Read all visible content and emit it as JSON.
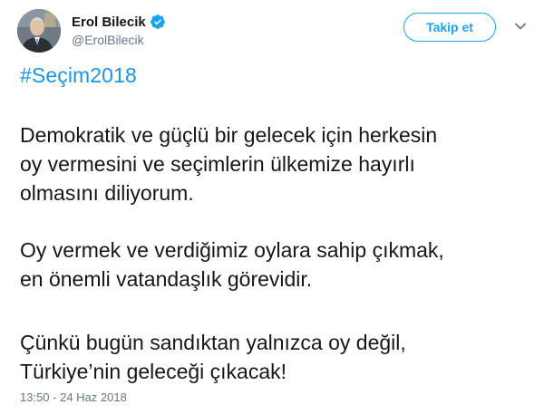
{
  "user": {
    "display_name": "Erol Bilecik",
    "handle": "@ErolBilecik",
    "verified": true
  },
  "actions": {
    "follow_label": "Takip et"
  },
  "tweet": {
    "hashtag": "#Seçim2018",
    "paragraphs": [
      [
        "Demokratik ve güçlü bir gelecek için herkesin",
        "oy vermesini ve seçimlerin ülkemize hayırlı",
        "olmasını diliyorum."
      ],
      [
        "Oy vermek ve verdiğimiz oylara sahip çıkmak,",
        "en önemli vatandaşlık görevidir."
      ],
      [
        "Çünkü bugün sandıktan yalnızca oy değil,",
        "Türkiye’nin geleceği çıkacak!"
      ]
    ],
    "timestamp": "13:50 - 24 Haz 2018"
  },
  "colors": {
    "accent": "#1da1f2",
    "link": "#1b95e0",
    "text": "#14171a",
    "muted": "#657786"
  },
  "icons": {
    "verified": "verified-badge-icon",
    "more": "chevron-down-icon"
  }
}
